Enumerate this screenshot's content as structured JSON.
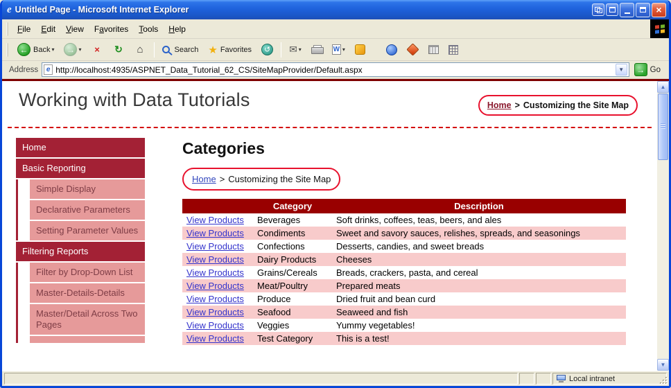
{
  "window": {
    "title": "Untitled Page - Microsoft Internet Explorer"
  },
  "menubar": {
    "items": [
      {
        "pre": "",
        "key": "F",
        "post": "ile"
      },
      {
        "pre": "",
        "key": "E",
        "post": "dit"
      },
      {
        "pre": "",
        "key": "V",
        "post": "iew"
      },
      {
        "pre": "F",
        "key": "a",
        "post": "vorites"
      },
      {
        "pre": "",
        "key": "T",
        "post": "ools"
      },
      {
        "pre": "",
        "key": "H",
        "post": "elp"
      }
    ]
  },
  "toolbar": {
    "back_label": "Back",
    "search_label": "Search",
    "favorites_label": "Favorites"
  },
  "addressbar": {
    "label": "Address",
    "url": "http://localhost:4935/ASPNET_Data_Tutorial_62_CS/SiteMapProvider/Default.aspx",
    "go_label": "Go"
  },
  "icons": {
    "ie_logo": "e",
    "address_page": "e",
    "back_arrow": "←",
    "forward_arrow": "→",
    "stop": "×",
    "refresh": "↻",
    "home": "⌂",
    "history": "↺",
    "favorites_star": "★",
    "mail": "✉",
    "edit_w": "W",
    "dropdown": "▾",
    "close": "×",
    "go_arrow": "→",
    "scroll_up": "▲",
    "scroll_down": "▼"
  },
  "page": {
    "title": "Working with Data Tutorials",
    "breadcrumb_top": {
      "home": "Home",
      "separator": ">",
      "current": "Customizing the Site Map"
    },
    "sidebar": {
      "items": [
        {
          "label": "Home",
          "level": 0
        },
        {
          "label": "Basic Reporting",
          "level": 0
        },
        {
          "label": "Simple Display",
          "level": 1
        },
        {
          "label": "Declarative Parameters",
          "level": 1
        },
        {
          "label": "Setting Parameter Values",
          "level": 1
        },
        {
          "label": "Filtering Reports",
          "level": 0
        },
        {
          "label": "Filter by Drop-Down List",
          "level": 1
        },
        {
          "label": "Master-Details-Details",
          "level": 1
        },
        {
          "label": "Master/Detail Across Two Pages",
          "level": 1
        }
      ]
    },
    "content": {
      "heading": "Categories",
      "breadcrumb": {
        "home": "Home",
        "separator": ">",
        "current": "Customizing the Site Map"
      },
      "table": {
        "headers": [
          "",
          "Category",
          "Description"
        ],
        "rows": [
          {
            "link": "View Products",
            "category": "Beverages",
            "description": "Soft drinks, coffees, teas, beers, and ales"
          },
          {
            "link": "View Products",
            "category": "Condiments",
            "description": "Sweet and savory sauces, relishes, spreads, and seasonings"
          },
          {
            "link": "View Products",
            "category": "Confections",
            "description": "Desserts, candies, and sweet breads"
          },
          {
            "link": "View Products",
            "category": "Dairy Products",
            "description": "Cheeses"
          },
          {
            "link": "View Products",
            "category": "Grains/Cereals",
            "description": "Breads, crackers, pasta, and cereal"
          },
          {
            "link": "View Products",
            "category": "Meat/Poultry",
            "description": "Prepared meats"
          },
          {
            "link": "View Products",
            "category": "Produce",
            "description": "Dried fruit and bean curd"
          },
          {
            "link": "View Products",
            "category": "Seafood",
            "description": "Seaweed and fish"
          },
          {
            "link": "View Products",
            "category": "Veggies",
            "description": "Yummy vegetables!"
          },
          {
            "link": "View Products",
            "category": "Test Category",
            "description": "This is a test!"
          }
        ]
      }
    }
  },
  "statusbar": {
    "zone": "Local intranet"
  },
  "colors": {
    "titlebar_blue": "#1E62DC",
    "chrome_tan": "#ECE9D8",
    "table_header_red": "#990000",
    "row_pink": "#F8CBCB",
    "sidebar_dark": "#A32135",
    "sidebar_light": "#E69A9A",
    "annotation_red": "#E8112D",
    "link_blue": "#3347BE",
    "maroon_link": "#8B1A2E"
  }
}
